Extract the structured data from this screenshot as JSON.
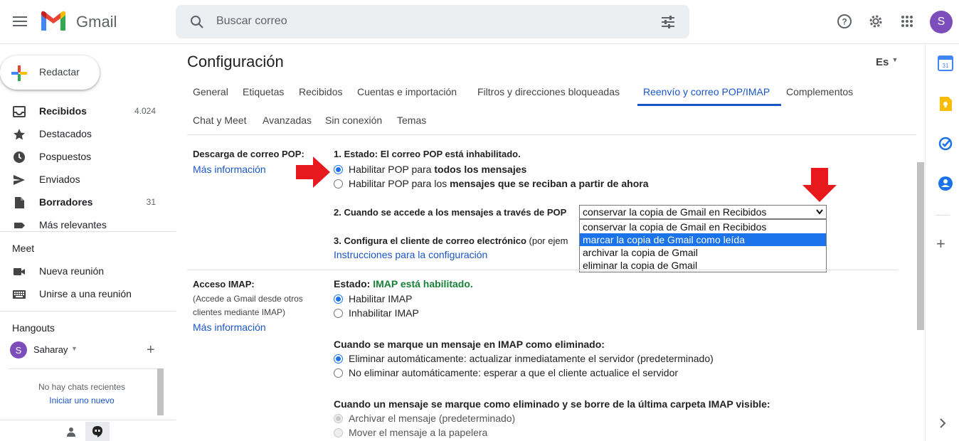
{
  "header": {
    "app_name": "Gmail",
    "search_placeholder": "Buscar correo",
    "avatar_letter": "S"
  },
  "sidebar": {
    "compose_label": "Redactar",
    "items": [
      {
        "label": "Recibidos",
        "count": "4.024",
        "bold": true,
        "icon": "inbox-icon"
      },
      {
        "label": "Destacados",
        "count": "",
        "bold": false,
        "icon": "star-icon"
      },
      {
        "label": "Pospuestos",
        "count": "",
        "bold": false,
        "icon": "clock-icon"
      },
      {
        "label": "Enviados",
        "count": "",
        "bold": false,
        "icon": "send-icon"
      },
      {
        "label": "Borradores",
        "count": "31",
        "bold": true,
        "icon": "draft-icon"
      },
      {
        "label": "Más relevantes",
        "count": "",
        "bold": false,
        "icon": "label-icon"
      }
    ],
    "meet": {
      "title": "Meet",
      "new_meeting": "Nueva reunión",
      "join_meeting": "Unirse a una reunión"
    },
    "hangouts": {
      "title": "Hangouts",
      "user": "Saharay",
      "user_letter": "S",
      "no_chats": "No hay chats recientes",
      "start_new": "Iniciar uno nuevo"
    }
  },
  "main": {
    "title": "Configuración",
    "lang": "Es",
    "tabs_row1": [
      "General",
      "Etiquetas",
      "Recibidos",
      "Cuentas e importación",
      "Filtros y direcciones bloqueadas",
      "Reenvío y correo POP/IMAP",
      "Complementos"
    ],
    "tabs_row2": [
      "Chat y Meet",
      "Avanzadas",
      "Sin conexión",
      "Temas"
    ],
    "active_tab": "Reenvío y correo POP/IMAP",
    "pop": {
      "label": "Descarga de correo POP:",
      "more_info": "Más información",
      "status": "1. Estado: El correo POP está inhabilitado.",
      "option1_prefix": "Habilitar POP para ",
      "option1_bold": "todos los mensajes",
      "option2_prefix": "Habilitar POP para los ",
      "option2_bold": "mensajes que se reciban a partir de ahora",
      "step2": "2. Cuando se accede a los mensajes a través de POP",
      "select_value": "conservar la copia de Gmail en Recibidos",
      "options": [
        "conservar la copia de Gmail en Recibidos",
        "marcar la copia de Gmail como leída",
        "archivar la copia de Gmail",
        "eliminar la copia de Gmail"
      ],
      "highlighted_option": 1,
      "step3_bold": "3. Configura el cliente de correo electrónico",
      "step3_rest": " (por ejem",
      "instructions": "Instrucciones para la configuración"
    },
    "imap": {
      "label": "Acceso IMAP:",
      "desc1": "(Accede a Gmail desde otros",
      "desc2": "clientes mediante IMAP)",
      "more_info": "Más información",
      "status_prefix": "Estado: ",
      "status_value": "IMAP está habilitado.",
      "enable": "Habilitar IMAP",
      "disable": "Inhabilitar IMAP",
      "deleted_title": "Cuando se marque un mensaje en IMAP como eliminado:",
      "auto_delete": "Eliminar automáticamente: actualizar inmediatamente el servidor (predeterminado)",
      "no_auto_delete": "No eliminar automáticamente: esperar a que el cliente actualice el servidor",
      "expunge_title": "Cuando un mensaje se marque como eliminado y se borre de la última carpeta IMAP visible:",
      "archive": "Archivar el mensaje (predeterminado)",
      "trash": "Mover el mensaje a la papelera"
    }
  },
  "colors": {
    "accent": "#1a73e8",
    "link": "#1a55c7",
    "success": "#188038",
    "arrow": "#e8191c",
    "avatar": "#7c4dbb"
  }
}
